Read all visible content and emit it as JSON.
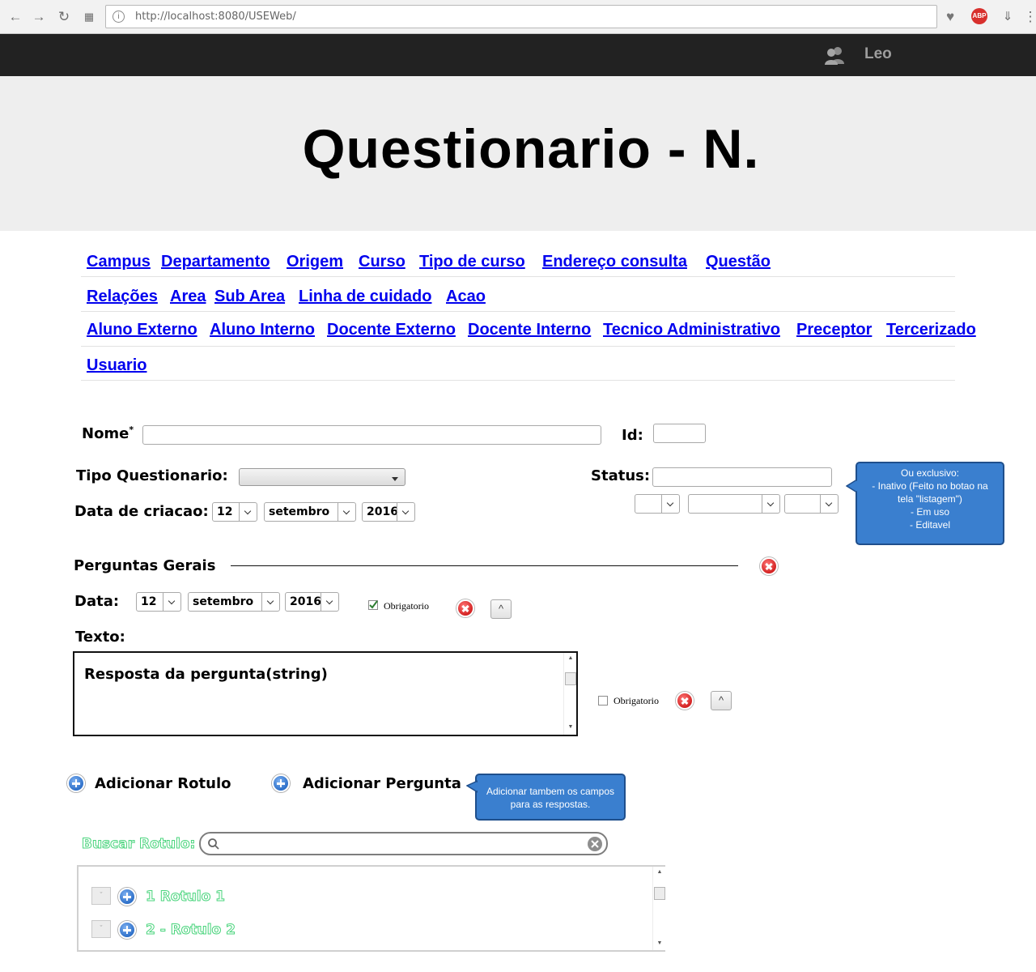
{
  "browser": {
    "url": "http://localhost:8080/USEWeb/",
    "adblock_label": "ABP"
  },
  "topbar": {
    "user_name": "Leo"
  },
  "header": {
    "title": "Questionario - N."
  },
  "nav": {
    "rows": [
      [
        "Campus",
        "Departamento",
        "Origem",
        "Curso",
        "Tipo de curso",
        "Endereço consulta",
        "Questão"
      ],
      [
        "Relações",
        "Area",
        "Sub Area",
        "Linha de cuidado",
        "Acao"
      ],
      [
        "Aluno Externo",
        "Aluno Interno",
        "Docente Externo",
        "Docente Interno",
        "Tecnico Administrativo",
        "Preceptor",
        "Tercerizado"
      ],
      [
        "Usuario"
      ]
    ]
  },
  "form": {
    "nome_label": "Nome",
    "required_mark": "*",
    "id_label": "Id:",
    "tipo_label": "Tipo Questionario:",
    "status_label": "Status:",
    "data_criacao_label": "Data de criacao:",
    "date_day": "12",
    "date_month": "setembro",
    "date_year": "2016"
  },
  "status_callout": {
    "lines": [
      "Ou exclusivo:",
      "- Inativo (Feito no botao na",
      "tela \"listagem\")",
      "- Em uso",
      "- Editavel"
    ]
  },
  "perguntas": {
    "section_title": "Perguntas Gerais",
    "data_label": "Data:",
    "date_day": "12",
    "date_month": "setembro",
    "date_year": "2016",
    "obrigatorio_label": "Obrigatorio",
    "obrigatorio_checked": true,
    "texto_label": "Texto:",
    "resposta_text": "Resposta da pergunta(string)",
    "obrigatorio2_label": "Obrigatorio",
    "obrigatorio2_checked": false,
    "up_label": "^"
  },
  "actions": {
    "add_rotulo": "Adicionar Rotulo",
    "add_pergunta": "Adicionar Pergunta",
    "callout": "Adicionar tambem os campos para as respostas."
  },
  "rotulo_search": {
    "label": "Buscar Rotulo:",
    "items": [
      "1 Rotulo 1",
      "2 - Rotulo 2"
    ]
  }
}
